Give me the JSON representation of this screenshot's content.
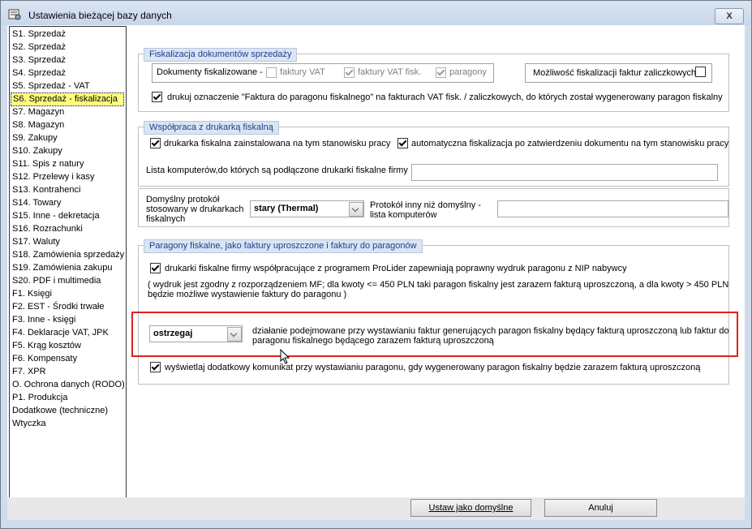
{
  "window": {
    "title": "Ustawienia bieżącej bazy danych",
    "close_label": "X"
  },
  "sidebar": {
    "items": [
      "S1. Sprzedaż",
      "S2. Sprzedaż",
      "S3. Sprzedaż",
      "S4. Sprzedaż",
      "S5. Sprzedaż - VAT",
      "S6. Sprzedaż - fiskalizacja",
      "S7. Magazyn",
      "S8. Magazyn",
      "S9. Zakupy",
      "S10. Zakupy",
      "S11. Spis z natury",
      "S12. Przelewy i kasy",
      "S13. Kontrahenci",
      "S14. Towary",
      "S15. Inne - dekretacja",
      "S16. Rozrachunki",
      "S17. Waluty",
      "S18. Zamówienia sprzedaży",
      "S19. Zamówienia zakupu",
      "S20. PDF i multimedia",
      "F1. Księgi",
      "F2. EST - Środki trwałe",
      "F3. Inne - księgi",
      "F4. Deklaracje VAT, JPK",
      "F5. Krąg kosztów",
      "F6. Kompensaty",
      "F7. XPR",
      "O. Ochrona danych (RODO)",
      "P1. Produkcja",
      "Dodatkowe (techniczne)",
      "Wtyczka"
    ],
    "selected_index": 5
  },
  "fiskalizacja": {
    "legend": "Fiskalizacja dokumentów sprzedaży",
    "docs_label": "Dokumenty fiskalizowane -",
    "cb_faktury_vat": "faktury VAT",
    "cb_faktury_vat_fisk": "faktury VAT fisk.",
    "cb_paragony": "paragony",
    "zaliczkowe_label": "Możliwość fiskalizacji faktur zaliczkowych",
    "drukuj_label": "drukuj oznaczenie \"Faktura do paragonu fiskalnego\" na fakturach VAT fisk. / zaliczkowych, do których został wygenerowany paragon fiskalny"
  },
  "wspolpraca": {
    "legend": "Współpraca z drukarką fiskalną",
    "cb_zainstalowana": "drukarka fiskalna zainstalowana na tym stanowisku pracy",
    "cb_automatyczna": "automatyczna fiskalizacja po zatwierdzeniu dokumentu na tym stanowisku pracy",
    "lista_label": "Lista komputerów,do których są podłączone drukarki fiskalne firmy",
    "lista_value": "",
    "protokol_label": "Domyślny protokół stosowany w drukarkach fiskalnych",
    "protokol_value": "stary (Thermal)",
    "protokol_inny_label": "Protokół inny niż domyślny - lista komputerów",
    "protokol_inny_value": ""
  },
  "paragony": {
    "legend": "Paragony fiskalne, jako faktury uproszczone i faktury do paragonów",
    "cb_nip": "drukarki fiskalne firmy współpracujące z programem ProLider zapewniają poprawny wydruk paragonu z NIP nabywcy",
    "note_line1": "( wydruk jest zgodny z rozporządzeniem MF; dla kwoty <= 450 PLN taki paragon fiskalny jest zarazem fakturą uproszczoną, a dla kwoty > 450 PLN",
    "note_line2": "będzie możliwe wystawienie faktury do paragonu )",
    "action_value": "ostrzegaj",
    "action_line1": "działanie podejmowane przy wystawianiu faktur generujących paragon fiskalny będący fakturą uproszczoną lub faktur do",
    "action_line2": "paragonu fiskalnego będącego zarazem fakturą uproszczoną",
    "cb_komunikat": "wyświetlaj dodatkowy komunikat przy wystawianiu paragonu, gdy wygenerowany paragon fiskalny będzie zarazem fakturą uproszczoną"
  },
  "footer": {
    "default_button": "Ustaw jako domyślne",
    "cancel_button": "Anuluj"
  },
  "colors": {
    "highlight_border": "#e02020",
    "selected_bg": "#ffff80",
    "legend_text": "#1d3f8f"
  }
}
